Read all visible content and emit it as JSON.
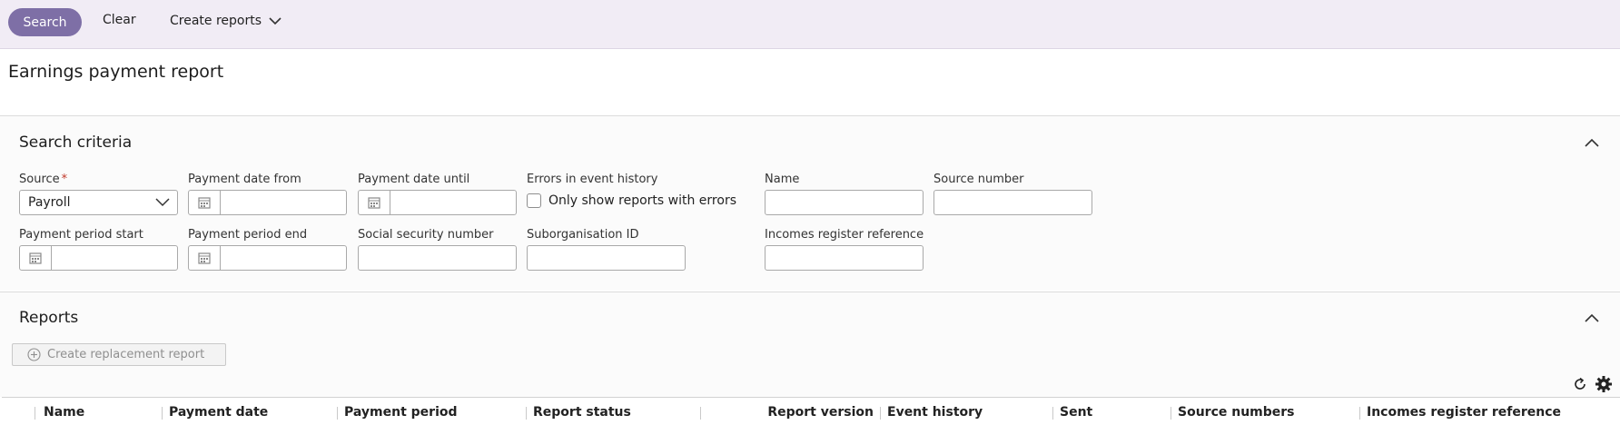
{
  "toolbar": {
    "search_label": "Search",
    "clear_label": "Clear",
    "create_reports_label": "Create reports"
  },
  "page": {
    "title": "Earnings payment report"
  },
  "search_criteria": {
    "title": "Search criteria",
    "fields": {
      "source": {
        "label": "Source",
        "value": "Payroll",
        "required_mark": "*"
      },
      "payment_date_from": {
        "label": "Payment date from",
        "value": ""
      },
      "payment_date_until": {
        "label": "Payment date until",
        "value": ""
      },
      "errors_in_event_history": {
        "label": "Errors in event history",
        "checkbox_label": "Only show reports with errors",
        "checked": false
      },
      "name": {
        "label": "Name",
        "value": ""
      },
      "source_number": {
        "label": "Source number",
        "value": ""
      },
      "payment_period_start": {
        "label": "Payment period start",
        "value": ""
      },
      "payment_period_end": {
        "label": "Payment period end",
        "value": ""
      },
      "social_security_number": {
        "label": "Social security number",
        "value": ""
      },
      "suborganisation_id": {
        "label": "Suborganisation ID",
        "value": ""
      },
      "incomes_register_reference": {
        "label": "Incomes register reference",
        "value": ""
      }
    }
  },
  "reports": {
    "title": "Reports",
    "create_replacement_label": "Create replacement report",
    "columns": [
      "Name",
      "Payment date",
      "Payment period",
      "Report status",
      "Report version",
      "Event history",
      "Sent",
      "Source numbers",
      "Incomes register reference"
    ]
  },
  "colors": {
    "accent": "#7e6fa6",
    "toolbar_bg": "#f1ecf5",
    "required": "#c0392b"
  }
}
